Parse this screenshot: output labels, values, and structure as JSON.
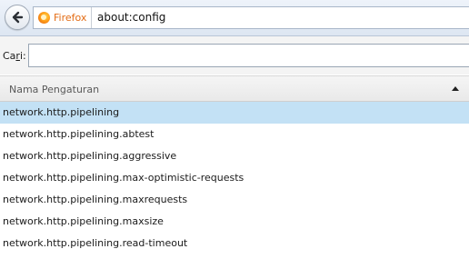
{
  "navbar": {
    "back_icon": "back-arrow-icon",
    "identity_icon": "firefox-icon",
    "identity_label": "Firefox",
    "url": "about:config",
    "accent": "#e36c14"
  },
  "search": {
    "label_prefix": "Ca",
    "label_underlined": "r",
    "label_suffix": "i:",
    "value": ""
  },
  "table": {
    "column_name": "Nama Pengaturan",
    "sort_icon": "sort-ascending-icon",
    "selected_color": "#c3e1f5",
    "rows": [
      {
        "name": "network.http.pipelining"
      },
      {
        "name": "network.http.pipelining.abtest"
      },
      {
        "name": "network.http.pipelining.aggressive"
      },
      {
        "name": "network.http.pipelining.max-optimistic-requests"
      },
      {
        "name": "network.http.pipelining.maxrequests"
      },
      {
        "name": "network.http.pipelining.maxsize"
      },
      {
        "name": "network.http.pipelining.read-timeout"
      }
    ]
  }
}
